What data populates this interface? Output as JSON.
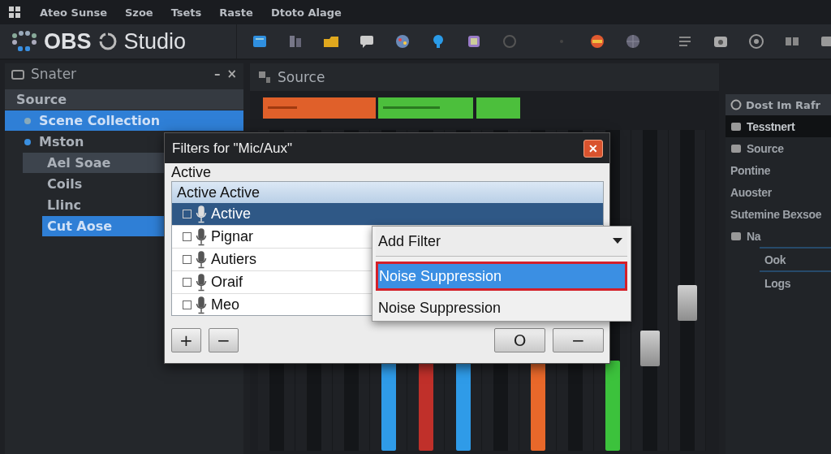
{
  "menu": [
    "Ateo Sunse",
    "Szoe",
    "Tsets",
    "Raste",
    "Dtoto Alage"
  ],
  "app_title": {
    "first": "OBS",
    "second": "Studio"
  },
  "scenes_panel": {
    "title": "Snater",
    "minimize": "–",
    "close": "×",
    "items": [
      {
        "label": "Source",
        "selected": false,
        "highlighted": true,
        "children": [
          {
            "label": "Scene Collection",
            "selected": true
          },
          {
            "label": "Mston",
            "selected": false,
            "highlighted": false,
            "children": [
              {
                "label": "Ael Soae",
                "selected": false,
                "highlighted": true
              },
              {
                "label": "Coils",
                "selected": false,
                "highlighted": false
              },
              {
                "label": "Llinc",
                "selected": false,
                "highlighted": false
              },
              {
                "label": "Cut Aose",
                "selected": true
              }
            ]
          }
        ]
      }
    ]
  },
  "mixer": {
    "tab": "Source",
    "channels": [
      {
        "kind": "empty"
      },
      {
        "kind": "empty"
      },
      {
        "kind": "empty"
      },
      {
        "kind": "meter",
        "color": "#2f9be8",
        "level": 0.28
      },
      {
        "kind": "meter",
        "color": "#c0302a",
        "level": 0.28
      },
      {
        "kind": "meter",
        "color": "#2f9be8",
        "level": 0.28
      },
      {
        "kind": "empty"
      },
      {
        "kind": "meter",
        "color": "#e8682a",
        "level": 0.28
      },
      {
        "kind": "empty"
      },
      {
        "kind": "meter",
        "color": "#3cc23c",
        "level": 0.28
      },
      {
        "kind": "fader",
        "level": 0.32
      },
      {
        "kind": "fader",
        "level": 0.46
      }
    ]
  },
  "right_panel": {
    "title": "Dost Im Rafr",
    "items": [
      {
        "label": "Tesstnert",
        "icon": true,
        "selected": true
      },
      {
        "label": "Source",
        "icon": true,
        "selected": false
      },
      {
        "label": "Pontine",
        "icon": false,
        "selected": false
      },
      {
        "label": "Auoster",
        "icon": false,
        "selected": false
      },
      {
        "label": "Sutemine Bexsoe",
        "icon": false,
        "selected": false
      },
      {
        "label": "Na",
        "icon": true,
        "selected": false,
        "children": [
          {
            "label": "Ook",
            "icon": false,
            "selected": true
          },
          {
            "label": "Logs",
            "icon": false,
            "selected": false
          }
        ]
      }
    ]
  },
  "filters_dialog": {
    "title": "Filters for \"Mic/Aux\"",
    "close": "✕",
    "section_label": "Active",
    "list_header": "Active Active",
    "rows": [
      {
        "label": "Active",
        "checked": false,
        "selected": true
      },
      {
        "label": "Pignar",
        "checked": false,
        "selected": false
      },
      {
        "label": "Autiers",
        "checked": false,
        "selected": false
      },
      {
        "label": "Oraif",
        "checked": false,
        "selected": false
      },
      {
        "label": "Meo",
        "checked": false,
        "selected": false
      }
    ],
    "left_buttons": [
      "+",
      "−"
    ],
    "right_buttons": [
      "O",
      "−"
    ]
  },
  "add_filter_menu": {
    "label": "Add Filter",
    "items": [
      {
        "label": "Noise Suppression",
        "selected": true
      },
      {
        "label": "Noise Suppression",
        "selected": false
      }
    ]
  }
}
